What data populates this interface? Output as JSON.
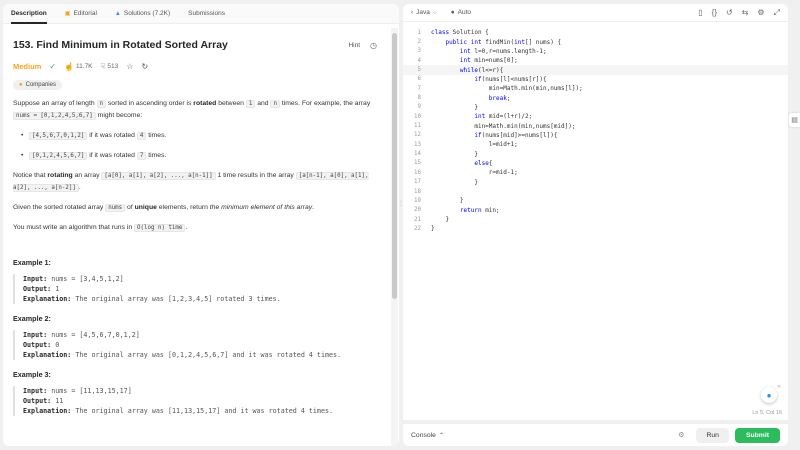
{
  "tabs": [
    {
      "label": "Description",
      "icon": ""
    },
    {
      "label": "Editorial",
      "icon": "book-icon"
    },
    {
      "label": "Solutions (7.2K)",
      "icon": "flask-icon"
    },
    {
      "label": "Submissions",
      "icon": ""
    }
  ],
  "problem": {
    "title": "153. Find Minimum in Rotated Sorted Array",
    "hint": "Hint",
    "difficulty": "Medium",
    "likes": "11.7K",
    "dislikes": "513",
    "companies": "Companies"
  },
  "desc": {
    "p1_a": "Suppose an array of length ",
    "p1_n": "n",
    "p1_b": " sorted in ascending order is ",
    "p1_rot": "rotated",
    "p1_c": " between ",
    "p1_1": "1",
    "p1_d": " and ",
    "p1_n2": "n",
    "p1_e": " times. For example, the array ",
    "p1_nums": "nums = [0,1,2,4,5,6,7]",
    "p1_f": " might become:",
    "b1_code": "[4,5,6,7,0,1,2]",
    "b1_a": " if it was rotated ",
    "b1_n": "4",
    "b1_b": " times.",
    "b2_code": "[0,1,2,4,5,6,7]",
    "b2_a": " if it was rotated ",
    "b2_n": "7",
    "b2_b": " times.",
    "p2_a": "Notice that ",
    "p2_rot": "rotating",
    "p2_b": " an array ",
    "p2_arr": "[a[0], a[1], a[2], ..., a[n-1]]",
    "p2_c": " 1 time results in the array ",
    "p2_res": "[a[n-1], a[0], a[1], a[2], ..., a[n-2]]",
    "p2_d": ".",
    "p3_a": "Given the sorted rotated array ",
    "p3_nums": "nums",
    "p3_b": " of ",
    "p3_unique": "unique",
    "p3_c": " elements, return ",
    "p3_ret": "the minimum element of this array",
    "p3_d": ".",
    "p4_a": "You must write an algorithm that runs in ",
    "p4_code": "O(log n) time",
    "p4_b": "."
  },
  "examples": [
    {
      "title": "Example 1:",
      "input_label": "Input:",
      "input": " nums = [3,4,5,1,2]",
      "output_label": "Output:",
      "output": " 1",
      "expl_label": "Explanation:",
      "expl": " The original array was [1,2,3,4,5] rotated 3 times."
    },
    {
      "title": "Example 2:",
      "input_label": "Input:",
      "input": " nums = [4,5,6,7,0,1,2]",
      "output_label": "Output:",
      "output": " 0",
      "expl_label": "Explanation:",
      "expl": " The original array was [0,1,2,4,5,6,7] and it was rotated 4 times."
    },
    {
      "title": "Example 3:",
      "input_label": "Input:",
      "input": " nums = [11,13,15,17]",
      "output_label": "Output:",
      "output": " 11",
      "expl_label": "Explanation:",
      "expl": " The original array was [11,13,15,17] and it was rotated 4 times."
    }
  ],
  "editor": {
    "language": "Java",
    "auto": "Auto",
    "cursor_pos": "Ln 5, Col 16",
    "lines": [
      "class Solution {",
      "    public int findMin(int[] nums) {",
      "        int l=0,r=nums.length-1;",
      "        int min=nums[0];",
      "        while(l<=r){",
      "            if(nums[l]<nums[r]){",
      "                min=Math.min(min,nums[l]);",
      "                break;",
      "            }",
      "            int mid=(l+r)/2;",
      "            min=Math.min(min,nums[mid]);",
      "            if(nums[mid]>=nums[l]){",
      "                l=mid+1;",
      "            }",
      "            else{",
      "                r=mid-1;",
      "            }",
      "",
      "        }",
      "        return min;",
      "    }",
      "}"
    ]
  },
  "bottom": {
    "console": "Console",
    "run": "Run",
    "submit": "Submit"
  },
  "colors": {
    "accent_green": "#2cbb5d",
    "medium_orange": "#ffa116",
    "keyword_blue": "#0000ff"
  }
}
